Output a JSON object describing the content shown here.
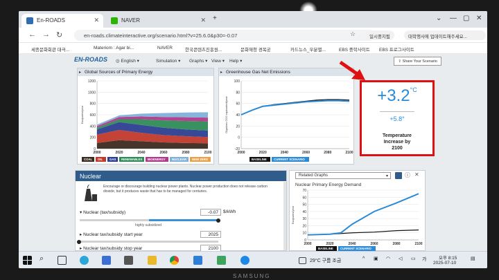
{
  "browser": {
    "tabs": [
      {
        "label": "En-ROADS",
        "icon_color": "#2f6db5"
      },
      {
        "label": "NAVER",
        "icon_color": "#2db400"
      }
    ],
    "url": "en-roads.climateinteractive.org/scenario.html?v=25.6.0&p30=-0.07",
    "profile_label": "일시중지됨",
    "other_pill": "대학행사에 업데이트해주세요...",
    "bookmarks": [
      "세종문화회관 대극...",
      "Materiom : Agar bi...",
      "NAVER",
      "한국콘텐츠진흥원...",
      "문화재청 경복궁",
      "카드뉴스_우분별...",
      "EBS 중학사이트",
      "EBS 프로그사이트"
    ]
  },
  "app": {
    "logo": "EN-ROADS",
    "menus": [
      "English",
      "Simulation",
      "Graphs",
      "View",
      "Help"
    ],
    "share_label": "Share Your Scenario",
    "panel1": {
      "title": "Global Sources of Primary Energy",
      "ylabel": "Exajoules/year",
      "legend": [
        {
          "label": "COAL",
          "color": "#3b2a1f"
        },
        {
          "label": "OIL",
          "color": "#c0392b"
        },
        {
          "label": "GAS",
          "color": "#2c3e91"
        },
        {
          "label": "RENEWABLES",
          "color": "#2e8b57"
        },
        {
          "label": "BIOENERGY",
          "color": "#b03a8a"
        },
        {
          "label": "NUCLEAR",
          "color": "#7fb0d8"
        },
        {
          "label": "NEW ZERO",
          "color": "#e8a04a"
        }
      ]
    },
    "panel2": {
      "title": "Greenhouse Gas Net Emissions",
      "ylabel": "Gigatons CO2 equivalent/year",
      "legend": [
        {
          "label": "BASELINE",
          "color": "#111111"
        },
        {
          "label": "CURRENT SCENARIO",
          "color": "#2a8ad6"
        }
      ]
    },
    "temperature": {
      "value": "+3.2",
      "unit": "°C",
      "fahrenheit": "+5.8°",
      "label_line1": "Temperature",
      "label_line2": "Increase by",
      "label_line3": "2100",
      "color": "#2a8ad6",
      "highlight_color": "#e01010"
    },
    "nuclear": {
      "title": "Nuclear",
      "description": "Encourage or discourage building nuclear power plants. Nuclear power production does not release carbon dioxide, but it produces waste that has to be managed for centuries.",
      "slider1_label": "Nuclear (tax/subsidy)",
      "slider1_value": "-0.07",
      "slider1_unit": "$/kWh",
      "slider1_caption": "highly subsidized",
      "slider1_level": 1.0,
      "slider2_label": "Nuclear tax/subsidy start year",
      "slider2_value": "2025",
      "slider3_label": "Nuclear tax/subsidy stop year",
      "slider3_value": "2100"
    },
    "related": {
      "select_label": "Related Graphs",
      "title": "Nuclear Primary Energy Demand",
      "ylabel": "Exajoules/year",
      "legend": [
        {
          "label": "BASELINE",
          "color": "#111111"
        },
        {
          "label": "CURRENT SCENARIO",
          "color": "#2a8ad6"
        }
      ]
    }
  },
  "taskbar": {
    "weather": "29°C  구름 조금",
    "time": "오후 8:15",
    "date": "2025-07-10"
  },
  "bezel_brand": "SAMSUNG",
  "chart_data": [
    {
      "type": "area",
      "title": "Global Sources of Primary Energy",
      "ylabel": "Exajoules/year",
      "x": [
        2000,
        2020,
        2040,
        2060,
        2080,
        2100
      ],
      "xlim": [
        2000,
        2100
      ],
      "ylim": [
        0,
        1200
      ],
      "yticks": [
        0,
        200,
        400,
        600,
        800,
        1000,
        1200
      ],
      "series": [
        {
          "name": "COAL",
          "values": [
            100,
            150,
            130,
            110,
            100,
            95
          ]
        },
        {
          "name": "OIL",
          "values": [
            150,
            180,
            150,
            130,
            120,
            110
          ]
        },
        {
          "name": "GAS",
          "values": [
            90,
            140,
            140,
            130,
            120,
            115
          ]
        },
        {
          "name": "RENEWABLES",
          "values": [
            30,
            50,
            100,
            130,
            150,
            160
          ]
        },
        {
          "name": "BIOENERGY",
          "values": [
            30,
            40,
            50,
            60,
            65,
            70
          ]
        },
        {
          "name": "NUCLEAR",
          "values": [
            25,
            30,
            50,
            70,
            85,
            95
          ]
        },
        {
          "name": "NEW ZERO",
          "values": [
            0,
            0,
            0,
            0,
            0,
            0
          ]
        }
      ]
    },
    {
      "type": "line",
      "title": "Greenhouse Gas Net Emissions",
      "ylabel": "Gigatons CO2 equivalent/year",
      "x": [
        2000,
        2010,
        2020,
        2030,
        2040,
        2050,
        2060,
        2070,
        2080,
        2090,
        2100
      ],
      "xlim": [
        2000,
        2100
      ],
      "ylim": [
        -20,
        100
      ],
      "yticks": [
        -20,
        0,
        20,
        40,
        60,
        80,
        100
      ],
      "series": [
        {
          "name": "BASELINE",
          "values": [
            40,
            48,
            55,
            58,
            60,
            62,
            64,
            66,
            67,
            67,
            66
          ]
        },
        {
          "name": "CURRENT SCENARIO",
          "values": [
            40,
            48,
            55,
            57,
            59,
            61,
            63,
            64,
            65,
            65,
            64
          ]
        }
      ]
    },
    {
      "type": "line",
      "title": "Nuclear Primary Energy Demand",
      "ylabel": "Exajoules/year",
      "x": [
        2000,
        2020,
        2030,
        2040,
        2060,
        2080,
        2100
      ],
      "xlim": [
        2000,
        2100
      ],
      "ylim": [
        0,
        70
      ],
      "yticks": [
        0,
        10,
        20,
        30,
        40,
        50,
        60,
        70
      ],
      "series": [
        {
          "name": "BASELINE",
          "values": [
            7,
            8,
            9,
            10,
            11,
            13,
            14
          ]
        },
        {
          "name": "CURRENT SCENARIO",
          "values": [
            7,
            8,
            10,
            22,
            40,
            52,
            65
          ]
        }
      ]
    }
  ]
}
